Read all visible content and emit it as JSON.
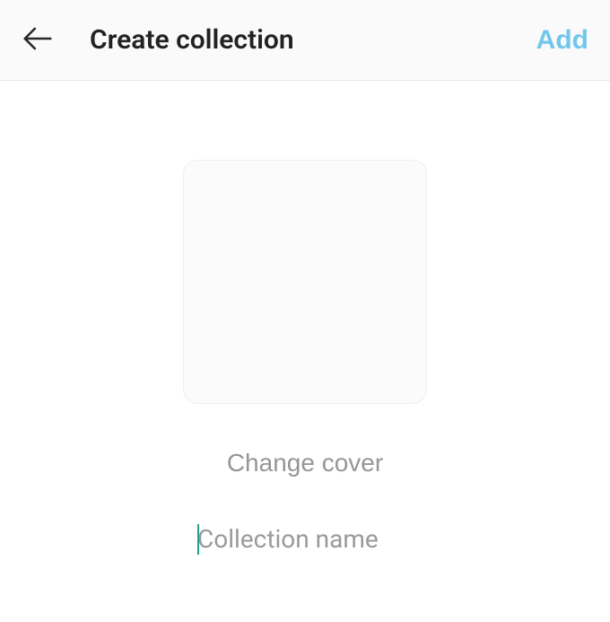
{
  "header": {
    "title": "Create collection",
    "add_label": "Add"
  },
  "main": {
    "change_cover_label": "Change cover",
    "name_input_value": "",
    "name_input_placeholder": "Collection name"
  },
  "colors": {
    "accent_link": "#72c6ec",
    "caret": "#1fa089",
    "muted_text": "#969696"
  }
}
